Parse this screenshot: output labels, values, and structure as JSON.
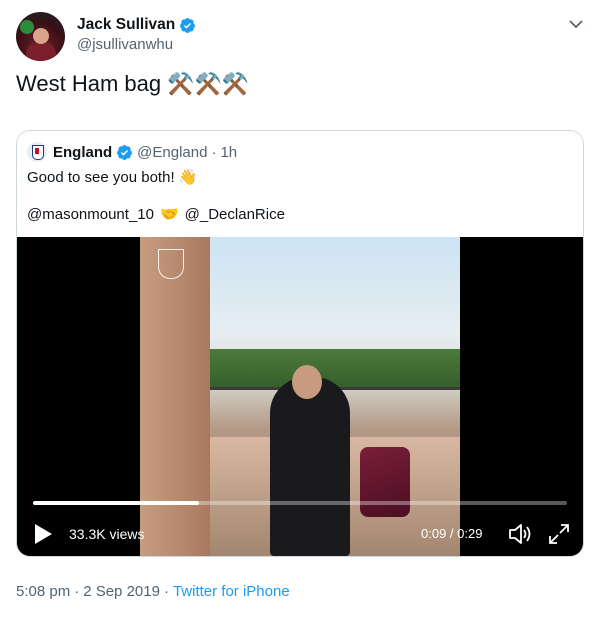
{
  "author": {
    "display_name": "Jack Sullivan",
    "handle": "@jsullivanwhu"
  },
  "tweet": {
    "text": "West Ham bag",
    "emoji": "⚒️⚒️⚒️"
  },
  "quoted": {
    "display_name": "England",
    "handle": "@England",
    "separator": "·",
    "time": "1h",
    "text_line1": "Good to see you both! 👋",
    "mention1": "@masonmount_10",
    "mention_emoji": "🤝",
    "mention2": "@_DeclanRice"
  },
  "video": {
    "views": "33.3K views",
    "timecode": "0:09 / 0:29",
    "progress": 0.31
  },
  "meta": {
    "time": "5:08 pm",
    "separator": "·",
    "date": "2 Sep 2019",
    "separator2": "·",
    "source": "Twitter for iPhone"
  },
  "colors": {
    "accent": "#1d9bf0",
    "muted": "#536471",
    "border": "#cfd9de"
  }
}
